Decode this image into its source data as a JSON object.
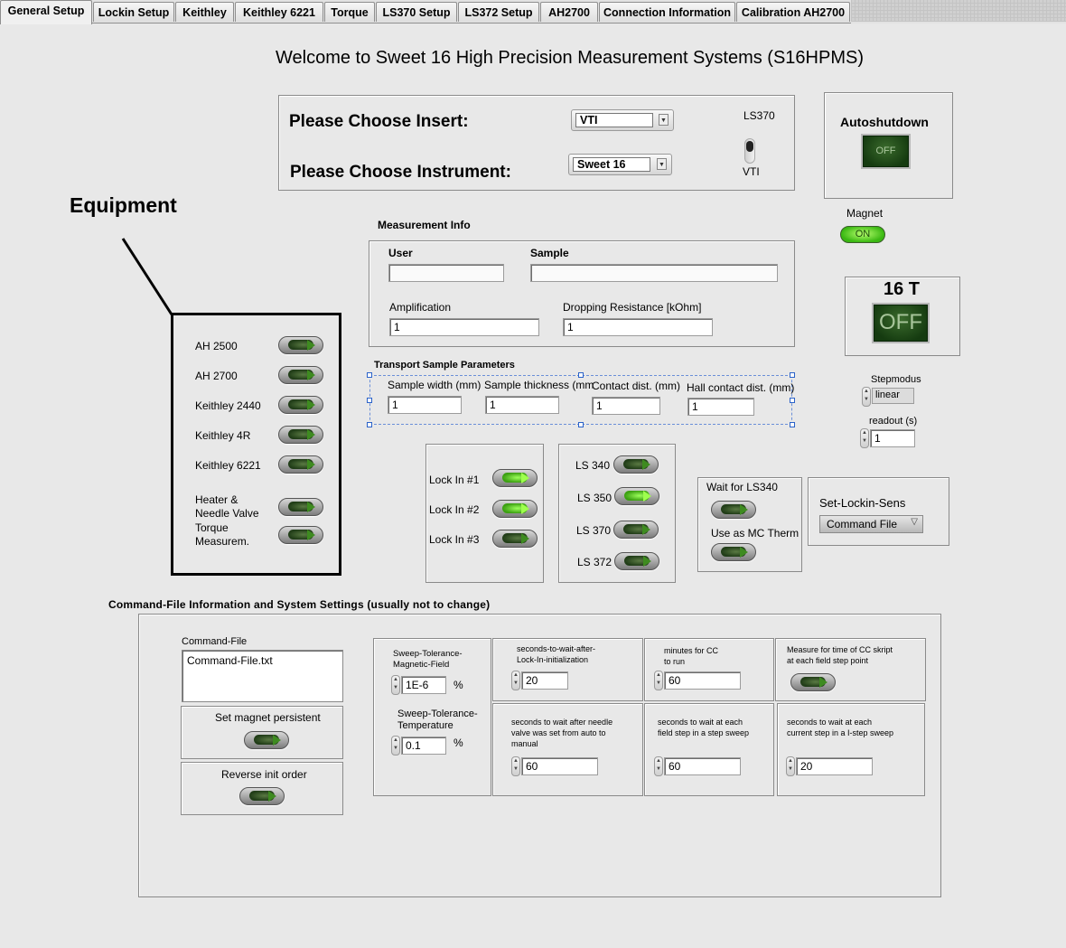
{
  "tabs": [
    "General Setup",
    "Lockin Setup",
    "Keithley",
    "Keithley 6221",
    "Torque",
    "LS370 Setup",
    "LS372 Setup",
    "AH2700",
    "Connection Information",
    "Calibration AH2700"
  ],
  "welcome": "Welcome to Sweet 16  High Precision Measurement Systems (S16HPMS)",
  "insert": {
    "label": "Please Choose Insert:",
    "value": "VTI"
  },
  "instrument": {
    "label": "Please Choose Instrument:",
    "value": "Sweet 16"
  },
  "ls_switch": {
    "top": "LS370",
    "bottom": "VTI"
  },
  "autoshutdown": {
    "title": "Autoshutdown",
    "button": "OFF"
  },
  "magnet": {
    "label": "Magnet",
    "button": "ON"
  },
  "sixteen_t": {
    "title": "16 T",
    "button": "OFF"
  },
  "equipment": {
    "title": "Equipment",
    "items": [
      "AH 2500",
      "AH 2700",
      "Keithley 2440",
      "Keithley 4R",
      "Keithley 6221",
      "Heater &\nNeedle Valve",
      "Torque\nMeasurem."
    ]
  },
  "measurement_info": {
    "title": "Measurement Info",
    "user": "User",
    "user_value": "",
    "sample": "Sample",
    "sample_value": "",
    "amplification": "Amplification",
    "amplification_value": "1",
    "dropping": "Dropping Resistance [kOhm]",
    "dropping_value": "1"
  },
  "transport": {
    "title": "Transport Sample  Parameters",
    "width": "Sample width (mm)",
    "width_value": "1",
    "thickness": "Sample thickness (mm)",
    "thickness_value": "1",
    "contact": "Contact dist. (mm)",
    "contact_value": "1",
    "hall": "Hall contact dist. (mm)",
    "hall_value": "1"
  },
  "stepmodus": {
    "label": "Stepmodus",
    "value": "linear"
  },
  "readout": {
    "label": "readout (s)",
    "value": "1"
  },
  "lockins": [
    "Lock In #1",
    "Lock In #2",
    "Lock In #3"
  ],
  "ls_list": [
    "LS 340",
    "LS 350",
    "LS 370",
    "LS 372"
  ],
  "wait_ls340": "Wait for LS340",
  "use_mc": "Use as MC Therm",
  "lockin_sens": {
    "title": "Set-Lockin-Sens",
    "value": "Command File"
  },
  "cmd_section": {
    "title": "Command-File Information and System Settings (usually not to change)",
    "cmd_file_label": "Command-File",
    "cmd_file_value": "Command-File.txt",
    "persistent": "Set magnet persistent",
    "reverse": "Reverse init order"
  },
  "sweep": {
    "magnetic_label": "Sweep-Tolerance-\nMagnetic-Field",
    "magnetic_value": "1E-6",
    "temp_label": "Sweep-Tolerance-\nTemperature",
    "temp_value": "0.1",
    "unit": "%"
  },
  "params": {
    "lockin_wait_label": "seconds-to-wait-after-\nLock-In-initialization",
    "lockin_wait_value": "20",
    "cc_label": "minutes for CC\nto run",
    "cc_value": "60",
    "measure_label": "Measure for time of CC skript\nat each field step point",
    "needle_label": "seconds to wait after needle\nvalve was set from auto to\nmanual",
    "needle_value": "60",
    "field_label": "seconds to wait at each\nfield step in a step sweep",
    "field_value": "60",
    "current_label": "seconds to wait at each\ncurrent step in a I-step sweep",
    "current_value": "20"
  }
}
